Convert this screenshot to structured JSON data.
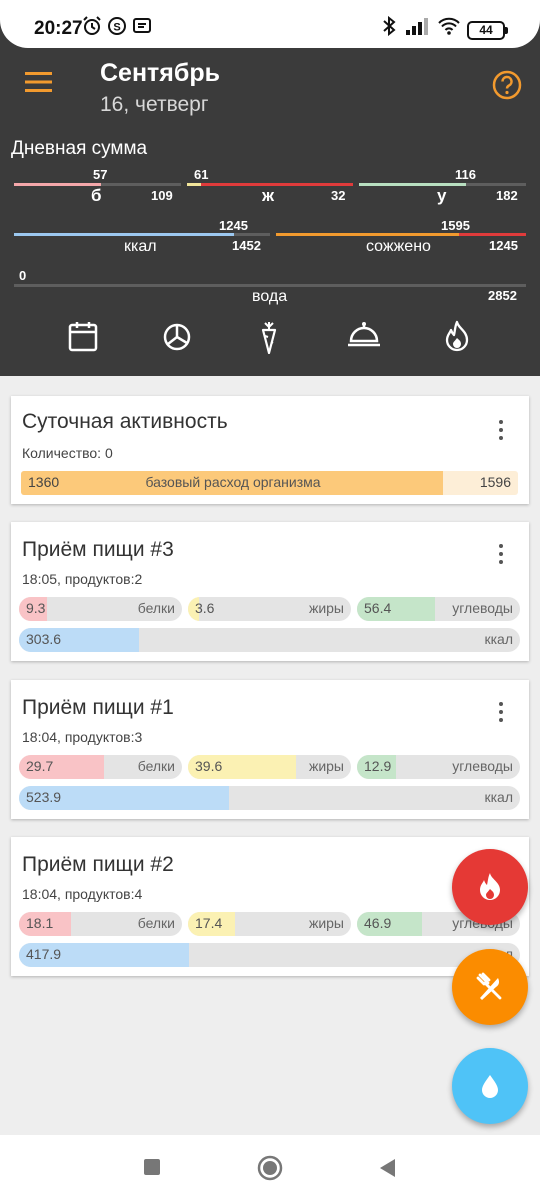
{
  "status_bar": {
    "time": "20:27",
    "battery": "44"
  },
  "header": {
    "month": "Сентябрь",
    "day": "16, четверг"
  },
  "daily_sum": {
    "title": "Дневная сумма",
    "protein": {
      "value": "57",
      "target": "109",
      "label": "б",
      "color": "#f4a7aa",
      "fraction": 0.52
    },
    "fat": {
      "value": "61",
      "target": "32",
      "label": "ж",
      "color": "#e03b3b",
      "fraction": 1.0
    },
    "carbs": {
      "value": "116",
      "target": "182",
      "label": "у",
      "color": "#b8dfc0",
      "fraction": 0.64
    },
    "kcal": {
      "value": "1245",
      "target": "1452",
      "label": "ккал",
      "color": "#9cc8f0",
      "fraction": 0.86
    },
    "burned": {
      "value": "1595",
      "target": "1245",
      "label": "сожжено",
      "color": "#f29a2e",
      "fraction": 1.0
    },
    "water": {
      "value": "0",
      "target": "2852",
      "label": "вода",
      "fraction": 0.0
    }
  },
  "nav_icons": [
    "calendar-icon",
    "pie-chart-icon",
    "carrot-icon",
    "cloche-icon",
    "flame-icon"
  ],
  "activity_card": {
    "title": "Суточная активность",
    "subtitle": "Количество: 0",
    "bar": {
      "value": "1360",
      "label": "базовый расход организма",
      "total": "1596",
      "fraction": 0.85,
      "color": "#fcc97a"
    }
  },
  "meals": [
    {
      "title": "Приём пищи #3",
      "subtitle": "18:05, продуктов:2",
      "protein": {
        "value": "9.3",
        "label": "белки",
        "fraction": 0.17
      },
      "fat": {
        "value": "3.6",
        "label": "жиры",
        "fraction": 0.07
      },
      "carbs": {
        "value": "56.4",
        "label": "углеводы",
        "fraction": 0.48
      },
      "kcal": {
        "value": "303.6",
        "label": "ккал",
        "fraction": 0.24
      }
    },
    {
      "title": "Приём пищи #1",
      "subtitle": "18:04, продуктов:3",
      "protein": {
        "value": "29.7",
        "label": "белки",
        "fraction": 0.52
      },
      "fat": {
        "value": "39.6",
        "label": "жиры",
        "fraction": 0.66
      },
      "carbs": {
        "value": "12.9",
        "label": "углеводы",
        "fraction": 0.24
      },
      "kcal": {
        "value": "523.9",
        "label": "ккал",
        "fraction": 0.42
      }
    },
    {
      "title": "Приём пищи #2",
      "subtitle": "18:04, продуктов:4",
      "protein": {
        "value": "18.1",
        "label": "белки",
        "fraction": 0.32
      },
      "fat": {
        "value": "17.4",
        "label": "жиры",
        "fraction": 0.29
      },
      "carbs": {
        "value": "46.9",
        "label": "углеводы",
        "fraction": 0.4
      },
      "kcal": {
        "value": "417.9",
        "label": "ккал",
        "fraction": 0.34
      }
    }
  ],
  "colors": {
    "accent": "#f29a2e",
    "protein_fill": "#f9c3c6",
    "fat_fill": "#fbf1b3",
    "carbs_fill": "#c5e5c9",
    "kcal_fill": "#bcdcf7",
    "fab_burn": "#e53935",
    "fab_food": "#fb8c00",
    "fab_water": "#4fc3f7"
  }
}
